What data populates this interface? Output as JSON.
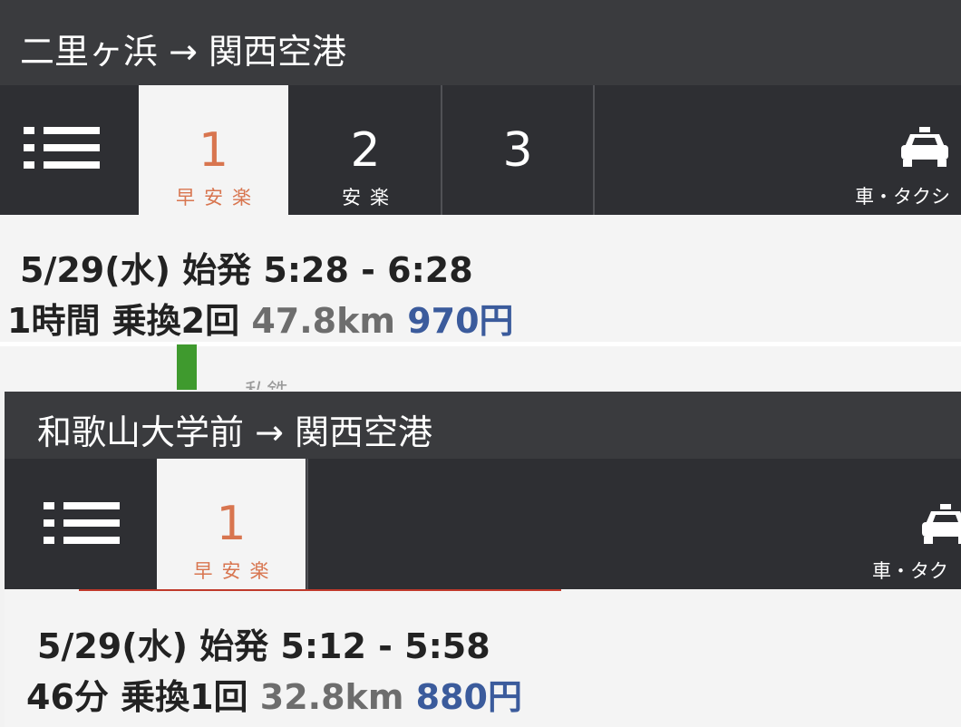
{
  "route1": {
    "title": "二里ヶ浜 → 関西空港",
    "tabs": [
      {
        "num": "1",
        "sub": "早安楽",
        "active": true
      },
      {
        "num": "2",
        "sub": "安楽",
        "active": false
      },
      {
        "num": "3",
        "sub": "",
        "active": false
      }
    ],
    "car_label": "車・タクシ",
    "schedule": "5/29(水) 始発  5:28 - 6:28",
    "duration": "1時間 乗換2回",
    "distance": "47.8km",
    "fare": "970円",
    "partial_line": "私鉄"
  },
  "route2": {
    "title": "和歌山大学前 → 関西空港",
    "tabs": [
      {
        "num": "1",
        "sub": "早安楽",
        "active": true
      }
    ],
    "car_label": "車・タク",
    "schedule": "5/29(水) 始発  5:12 - 5:58",
    "duration": "46分 乗換1回",
    "distance": "32.8km",
    "fare": "880円"
  },
  "colors": {
    "accent": "#d8754f",
    "fare_blue": "#3b5b9c",
    "line_green": "#3f9a2e",
    "bar_dark": "#2e2f33",
    "red_rule": "#c0392b"
  }
}
